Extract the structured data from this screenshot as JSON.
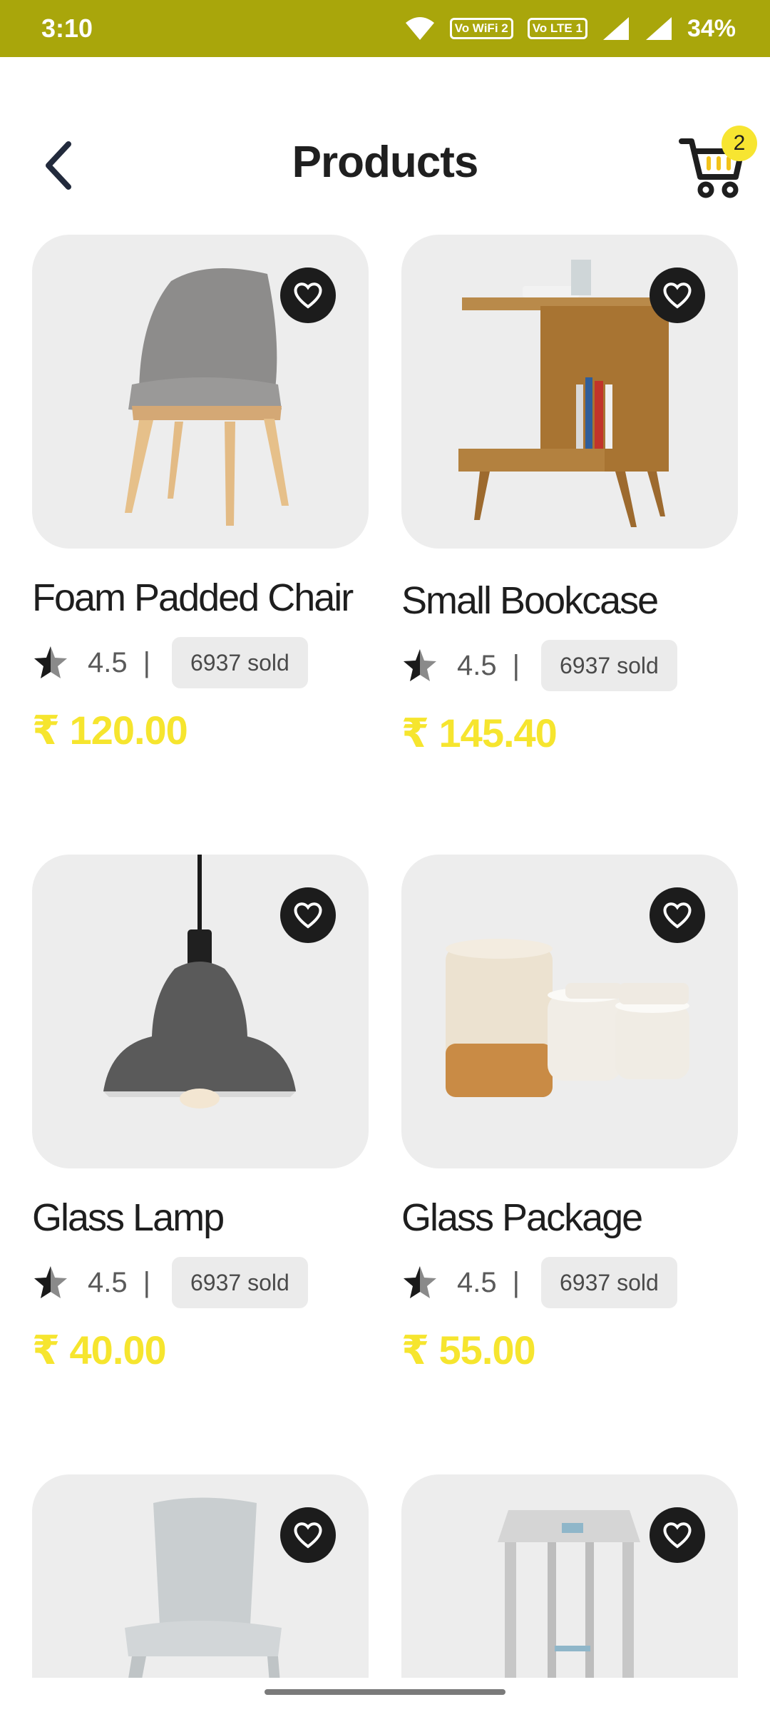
{
  "status": {
    "time": "3:10",
    "battery": "34%",
    "wifi_tag": "Vo WiFi 2",
    "lte_tag": "Vo LTE 1"
  },
  "header": {
    "title": "Products",
    "cart_count": "2"
  },
  "products": [
    {
      "name": "Foam Padded Chair",
      "rating": "4.5",
      "separator": "|",
      "sold": "6937 sold",
      "price": "₹ 120.00",
      "image": "chair-image"
    },
    {
      "name": "Small Bookcase",
      "rating": "4.5",
      "separator": "|",
      "sold": "6937 sold",
      "price": "₹ 145.40",
      "image": "bookcase-image"
    },
    {
      "name": "Glass Lamp",
      "rating": "4.5",
      "separator": "|",
      "sold": "6937 sold",
      "price": "₹ 40.00",
      "image": "lamp-image"
    },
    {
      "name": "Glass Package",
      "rating": "4.5",
      "separator": "|",
      "sold": "6937 sold",
      "price": "₹ 55.00",
      "image": "cups-image"
    },
    {
      "name": "",
      "rating": "",
      "separator": "",
      "sold": "",
      "price": "",
      "image": "plastic-chair-image"
    },
    {
      "name": "",
      "rating": "",
      "separator": "",
      "sold": "",
      "price": "",
      "image": "stool-image"
    }
  ],
  "colors": {
    "statusbar": "#a9a60b",
    "accent_price": "#f6e52e",
    "badge": "#f7e531",
    "card_bg": "#ededed"
  }
}
